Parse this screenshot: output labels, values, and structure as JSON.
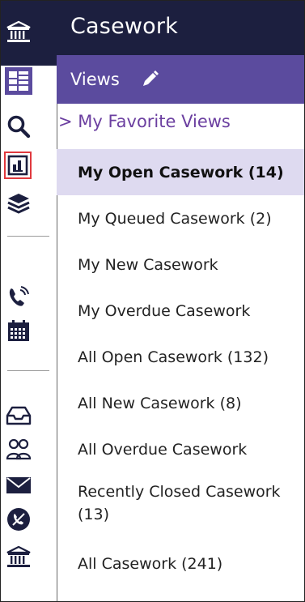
{
  "header": {
    "title": "Casework"
  },
  "views_bar": {
    "label": "Views"
  },
  "favorites": {
    "label": "> My Favorite Views"
  },
  "views": [
    {
      "label": "My Open Casework (14)",
      "selected": true
    },
    {
      "label": "My Queued Casework (2)"
    },
    {
      "label": "My New Casework"
    },
    {
      "label": "My Overdue Casework"
    },
    {
      "label": "All Open Casework (132)"
    },
    {
      "label": "All New Casework (8)"
    },
    {
      "label": "All Overdue Casework"
    },
    {
      "label": "Recently Closed Casework (13)"
    },
    {
      "label": "All Casework (241)"
    }
  ],
  "rail": {
    "icons": [
      "bank-icon",
      "dashboard-icon",
      "search-icon",
      "bar-chart-icon",
      "layers-icon",
      "phone-call-icon",
      "calendar-icon",
      "inbox-tray-icon",
      "people-icon",
      "envelope-icon",
      "no-phone-icon",
      "bank-icon"
    ]
  },
  "colors": {
    "header_bg": "#1c1f3f",
    "views_bar_bg": "#5b4b9e",
    "selected_bg": "#dedaf0",
    "favorites_text": "#6b3fa0",
    "highlight_border": "#e0393e"
  }
}
